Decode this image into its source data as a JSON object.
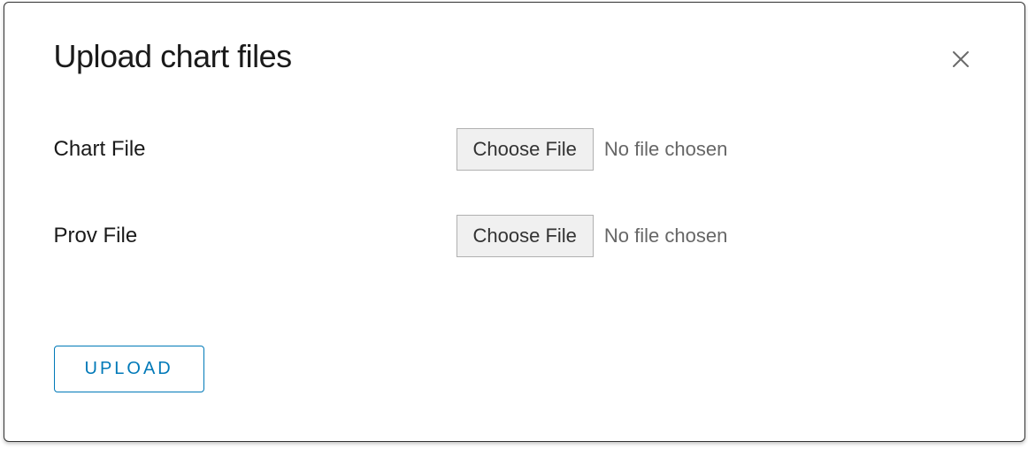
{
  "modal": {
    "title": "Upload chart files",
    "fields": [
      {
        "label": "Chart File",
        "button_label": "Choose File",
        "status": "No file chosen"
      },
      {
        "label": "Prov File",
        "button_label": "Choose File",
        "status": "No file chosen"
      }
    ],
    "upload_label": "UPLOAD"
  }
}
